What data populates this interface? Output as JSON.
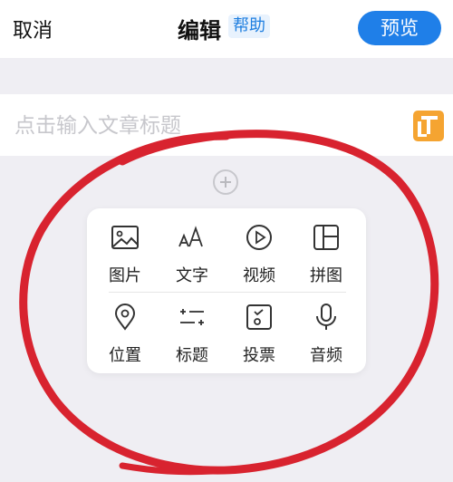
{
  "header": {
    "cancel_label": "取消",
    "title": "编辑",
    "help_label": "帮助",
    "preview_label": "预览"
  },
  "editor": {
    "title_placeholder": "点击输入文章标题"
  },
  "insert_menu": {
    "items": [
      {
        "label": "图片",
        "icon": "image-icon"
      },
      {
        "label": "文字",
        "icon": "text-icon"
      },
      {
        "label": "视频",
        "icon": "video-icon"
      },
      {
        "label": "拼图",
        "icon": "collage-icon"
      },
      {
        "label": "位置",
        "icon": "location-icon"
      },
      {
        "label": "标题",
        "icon": "heading-icon"
      },
      {
        "label": "投票",
        "icon": "vote-icon"
      },
      {
        "label": "音频",
        "icon": "microphone-icon"
      }
    ]
  },
  "colors": {
    "accent": "#1f7fe8",
    "template_icon": "#f5a431",
    "annotation": "#d8232f",
    "background": "#efeef3"
  }
}
